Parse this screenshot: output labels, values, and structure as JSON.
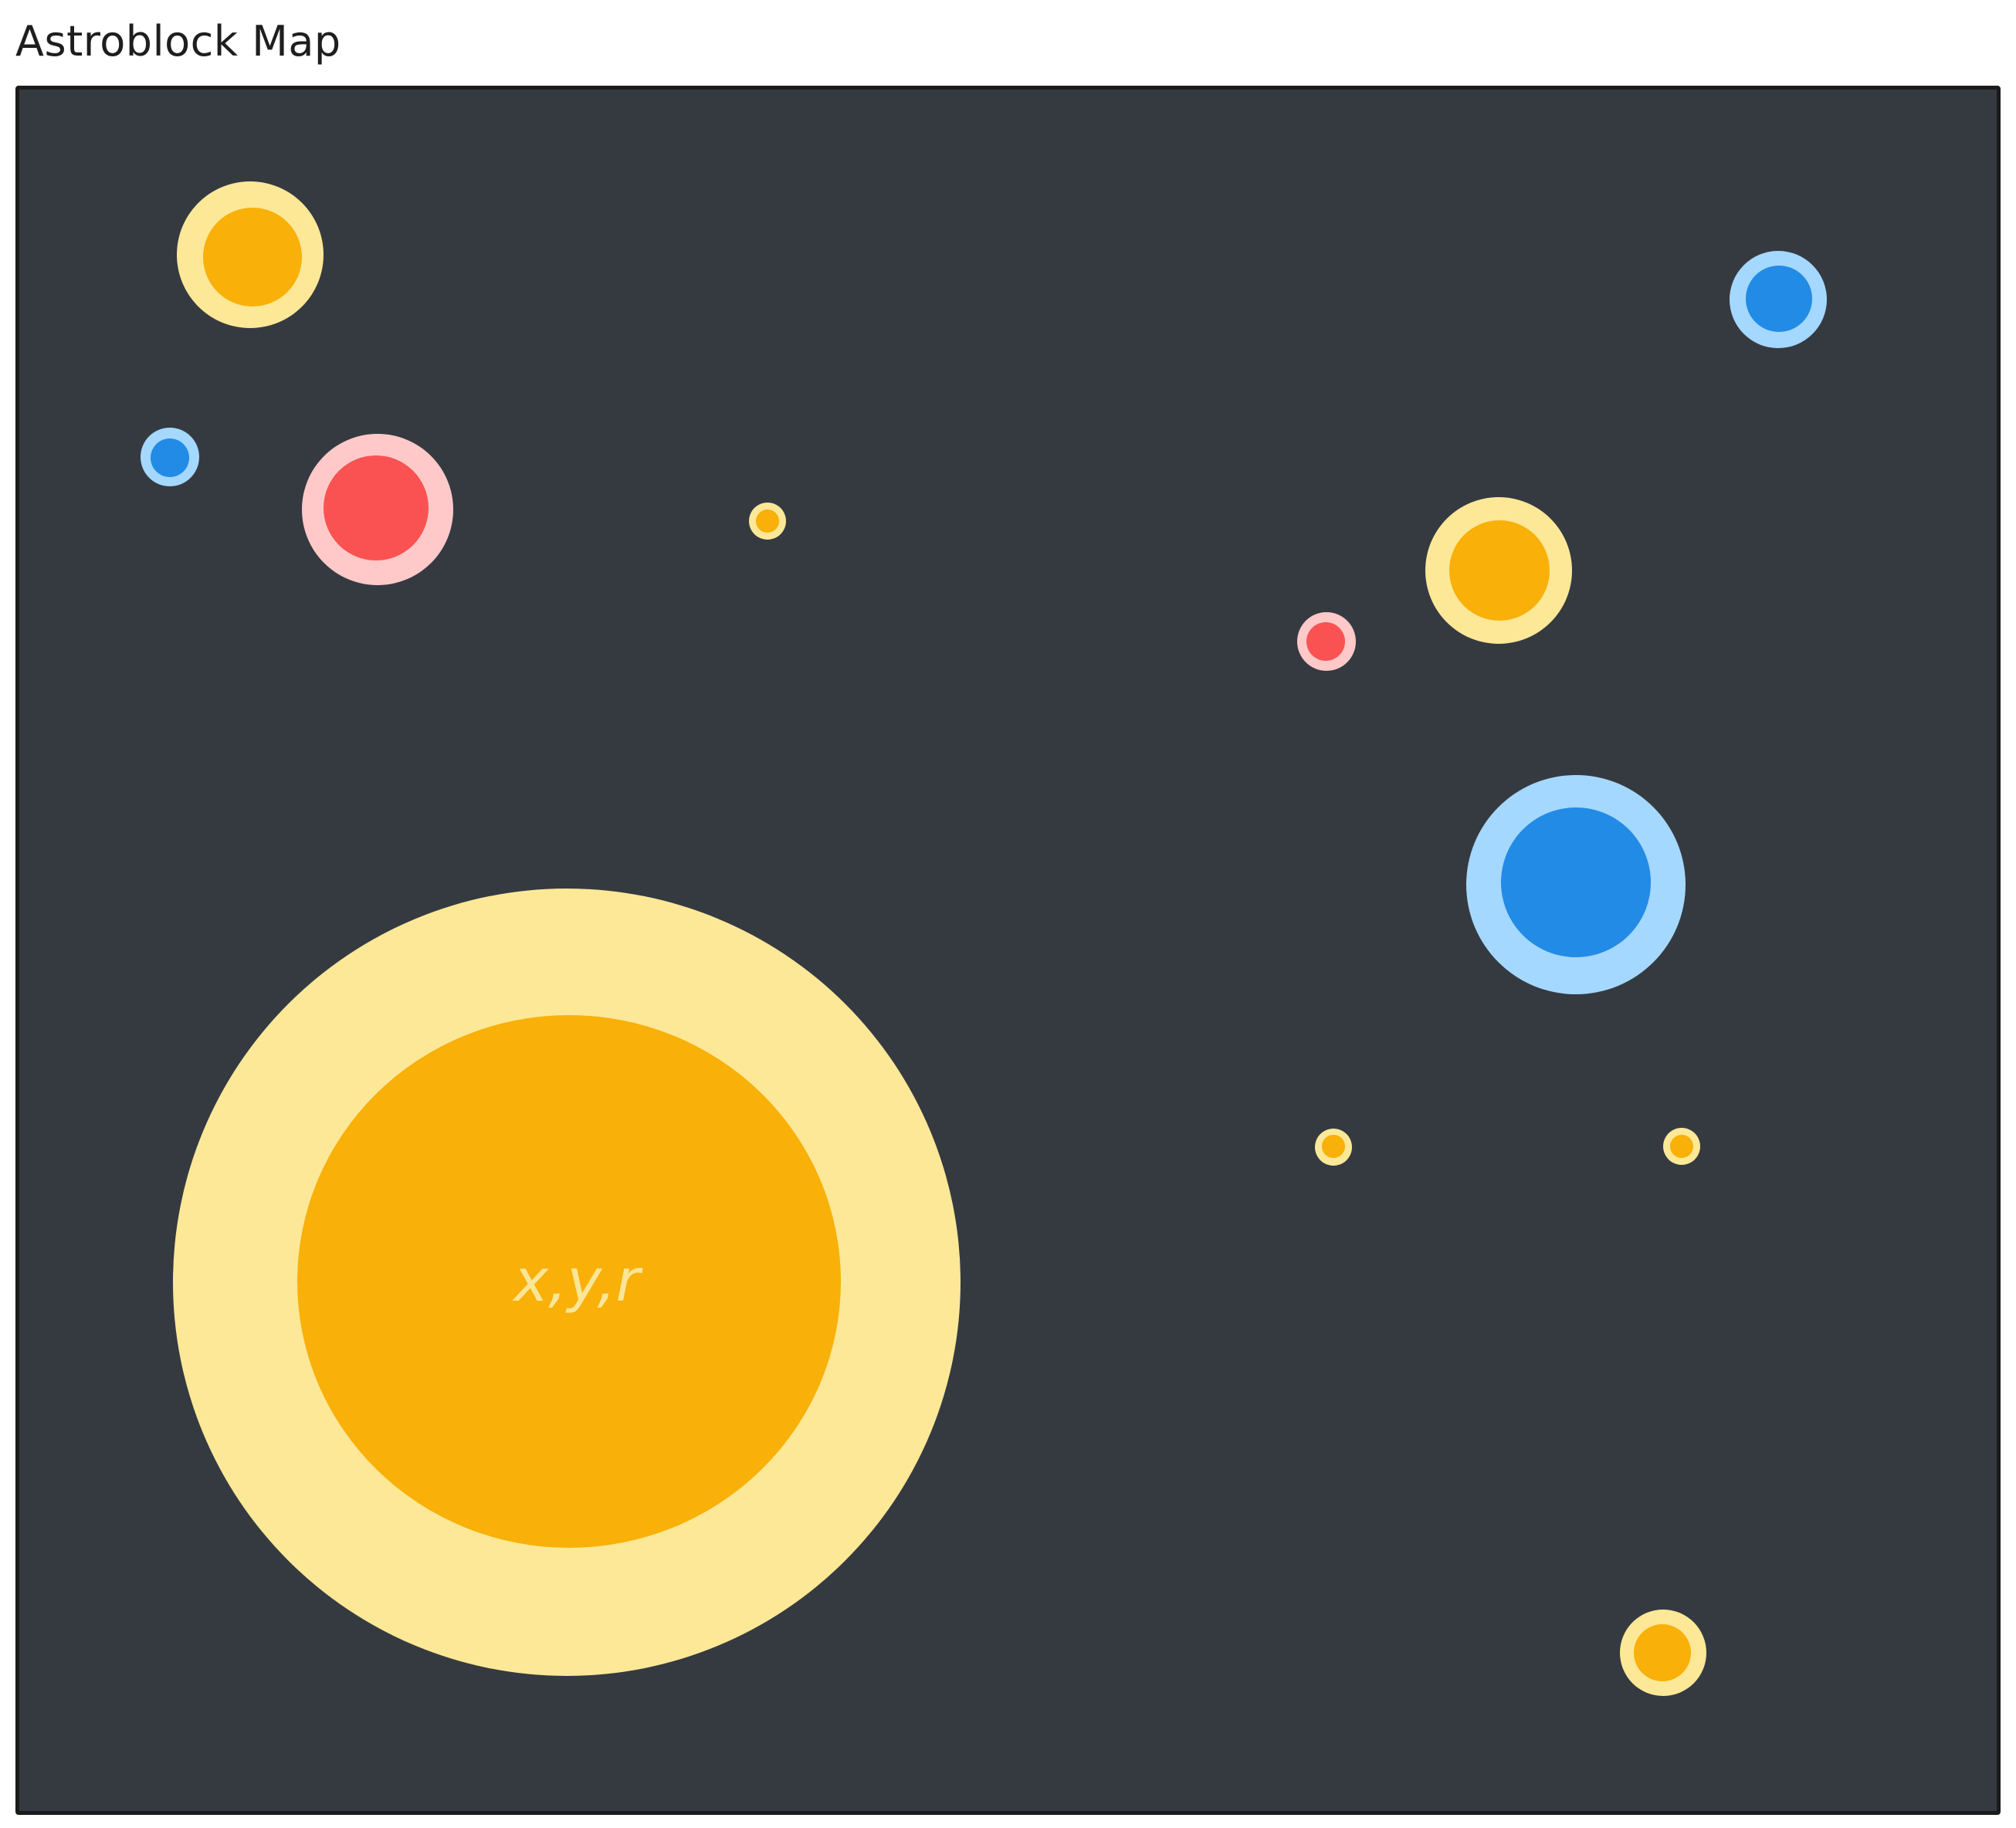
{
  "header": {
    "title": "Astroblock Map"
  },
  "map": {
    "center_label": "x,y,r",
    "colors": {
      "background": "#353a41",
      "frame_border": "#1b1b1b",
      "yellow_core": "#f9b008",
      "yellow_halo": "#fde897",
      "blue_core": "#228be6",
      "blue_halo": "#a5d8ff",
      "red_core": "#fa5252",
      "red_halo": "#ffc9c9"
    },
    "bodies": [
      {
        "name": "body-yellow-top-left",
        "color": "yellow"
      },
      {
        "name": "body-blue-small-left",
        "color": "blue"
      },
      {
        "name": "body-red-left",
        "color": "red"
      },
      {
        "name": "body-yellow-tiny-center",
        "color": "yellow"
      },
      {
        "name": "body-blue-top-right",
        "color": "blue"
      },
      {
        "name": "body-yellow-right-upper",
        "color": "yellow"
      },
      {
        "name": "body-red-small-right",
        "color": "red"
      },
      {
        "name": "body-blue-large-right",
        "color": "blue"
      },
      {
        "name": "body-yellow-tiny-right-a",
        "color": "yellow"
      },
      {
        "name": "body-yellow-tiny-right-b",
        "color": "yellow"
      },
      {
        "name": "body-yellow-bottom-right",
        "color": "yellow"
      },
      {
        "name": "body-yellow-giant",
        "color": "yellow"
      }
    ]
  }
}
